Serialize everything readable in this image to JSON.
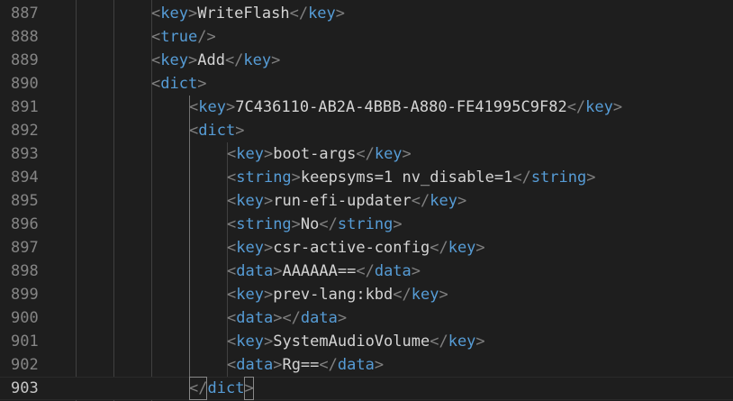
{
  "editor": {
    "lines": [
      {
        "n": "887",
        "indent": 0,
        "parts": [
          [
            "punc",
            "<"
          ],
          [
            "tag",
            "key"
          ],
          [
            "punc",
            ">"
          ],
          [
            "text",
            "WriteFlash"
          ],
          [
            "punc",
            "</"
          ],
          [
            "tag",
            "key"
          ],
          [
            "punc",
            ">"
          ]
        ]
      },
      {
        "n": "888",
        "indent": 0,
        "parts": [
          [
            "punc",
            "<"
          ],
          [
            "tag",
            "true"
          ],
          [
            "punc",
            "/>"
          ]
        ]
      },
      {
        "n": "889",
        "indent": 0,
        "parts": [
          [
            "punc",
            "<"
          ],
          [
            "tag",
            "key"
          ],
          [
            "punc",
            ">"
          ],
          [
            "text",
            "Add"
          ],
          [
            "punc",
            "</"
          ],
          [
            "tag",
            "key"
          ],
          [
            "punc",
            ">"
          ]
        ]
      },
      {
        "n": "890",
        "indent": 0,
        "parts": [
          [
            "punc",
            "<"
          ],
          [
            "tag",
            "dict"
          ],
          [
            "punc",
            ">"
          ]
        ]
      },
      {
        "n": "891",
        "indent": 1,
        "parts": [
          [
            "punc",
            "<"
          ],
          [
            "tag",
            "key"
          ],
          [
            "punc",
            ">"
          ],
          [
            "text",
            "7C436110-AB2A-4BBB-A880-FE41995C9F82"
          ],
          [
            "punc",
            "</"
          ],
          [
            "tag",
            "key"
          ],
          [
            "punc",
            ">"
          ]
        ]
      },
      {
        "n": "892",
        "indent": 1,
        "parts": [
          [
            "punc",
            "<"
          ],
          [
            "tag",
            "dict"
          ],
          [
            "punc",
            ">"
          ]
        ]
      },
      {
        "n": "893",
        "indent": 2,
        "parts": [
          [
            "punc",
            "<"
          ],
          [
            "tag",
            "key"
          ],
          [
            "punc",
            ">"
          ],
          [
            "text",
            "boot-args"
          ],
          [
            "punc",
            "</"
          ],
          [
            "tag",
            "key"
          ],
          [
            "punc",
            ">"
          ]
        ]
      },
      {
        "n": "894",
        "indent": 2,
        "parts": [
          [
            "punc",
            "<"
          ],
          [
            "tag",
            "string"
          ],
          [
            "punc",
            ">"
          ],
          [
            "text",
            "keepsyms=1 nv_disable=1"
          ],
          [
            "punc",
            "</"
          ],
          [
            "tag",
            "string"
          ],
          [
            "punc",
            ">"
          ]
        ]
      },
      {
        "n": "895",
        "indent": 2,
        "parts": [
          [
            "punc",
            "<"
          ],
          [
            "tag",
            "key"
          ],
          [
            "punc",
            ">"
          ],
          [
            "text",
            "run-efi-updater"
          ],
          [
            "punc",
            "</"
          ],
          [
            "tag",
            "key"
          ],
          [
            "punc",
            ">"
          ]
        ]
      },
      {
        "n": "896",
        "indent": 2,
        "parts": [
          [
            "punc",
            "<"
          ],
          [
            "tag",
            "string"
          ],
          [
            "punc",
            ">"
          ],
          [
            "text",
            "No"
          ],
          [
            "punc",
            "</"
          ],
          [
            "tag",
            "string"
          ],
          [
            "punc",
            ">"
          ]
        ]
      },
      {
        "n": "897",
        "indent": 2,
        "parts": [
          [
            "punc",
            "<"
          ],
          [
            "tag",
            "key"
          ],
          [
            "punc",
            ">"
          ],
          [
            "text",
            "csr-active-config"
          ],
          [
            "punc",
            "</"
          ],
          [
            "tag",
            "key"
          ],
          [
            "punc",
            ">"
          ]
        ]
      },
      {
        "n": "898",
        "indent": 2,
        "parts": [
          [
            "punc",
            "<"
          ],
          [
            "tag",
            "data"
          ],
          [
            "punc",
            ">"
          ],
          [
            "text",
            "AAAAAA=="
          ],
          [
            "punc",
            "</"
          ],
          [
            "tag",
            "data"
          ],
          [
            "punc",
            ">"
          ]
        ]
      },
      {
        "n": "899",
        "indent": 2,
        "parts": [
          [
            "punc",
            "<"
          ],
          [
            "tag",
            "key"
          ],
          [
            "punc",
            ">"
          ],
          [
            "text",
            "prev-lang:kbd"
          ],
          [
            "punc",
            "</"
          ],
          [
            "tag",
            "key"
          ],
          [
            "punc",
            ">"
          ]
        ]
      },
      {
        "n": "900",
        "indent": 2,
        "parts": [
          [
            "punc",
            "<"
          ],
          [
            "tag",
            "data"
          ],
          [
            "punc",
            "></"
          ],
          [
            "tag",
            "data"
          ],
          [
            "punc",
            ">"
          ]
        ]
      },
      {
        "n": "901",
        "indent": 2,
        "parts": [
          [
            "punc",
            "<"
          ],
          [
            "tag",
            "key"
          ],
          [
            "punc",
            ">"
          ],
          [
            "text",
            "SystemAudioVolume"
          ],
          [
            "punc",
            "</"
          ],
          [
            "tag",
            "key"
          ],
          [
            "punc",
            ">"
          ]
        ]
      },
      {
        "n": "902",
        "indent": 2,
        "parts": [
          [
            "punc",
            "<"
          ],
          [
            "tag",
            "data"
          ],
          [
            "punc",
            ">"
          ],
          [
            "text",
            "Rg=="
          ],
          [
            "punc",
            "</"
          ],
          [
            "tag",
            "data"
          ],
          [
            "punc",
            ">"
          ]
        ]
      },
      {
        "n": "903",
        "indent": 1,
        "current": true,
        "parts": [
          [
            "punc",
            "</"
          ],
          [
            "tag",
            "dict"
          ],
          [
            "punc",
            ">"
          ]
        ]
      }
    ]
  },
  "colors": {
    "background": "#1e1e1e",
    "tag": "#569cd6",
    "punctuation": "#808080",
    "text": "#d4d4d4",
    "line_number": "#858585",
    "line_number_current": "#c6c6c6"
  }
}
